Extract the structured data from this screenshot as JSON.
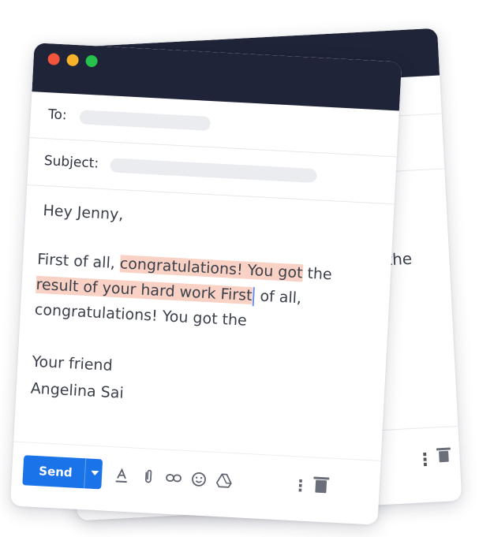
{
  "compose": {
    "to_label": "To:",
    "subject_label": "Subject:",
    "greeting": "Hey Jenny,",
    "body_line1_pre": "First of all, ",
    "body_line1_hl": "congratulations! You got",
    "body_line1_post": " the",
    "body_line2_hl": "result of your hard work First",
    "body_line2_post": " of all,",
    "body_line3": "congratulations! You got the",
    "signoff": "Your friend",
    "signature": "Angelina Sai"
  },
  "toolbar": {
    "send_label": "Send",
    "more_icon": "more-vert-icon",
    "trash_icon": "trash-icon"
  },
  "back_window": {
    "visible_text": "the"
  },
  "colors": {
    "titlebar": "#1f2438",
    "highlight": "#f9d2c5",
    "send": "#1a73e8",
    "dot_red": "#f2553b",
    "dot_yellow": "#f7b22a",
    "dot_green": "#27c24b"
  }
}
